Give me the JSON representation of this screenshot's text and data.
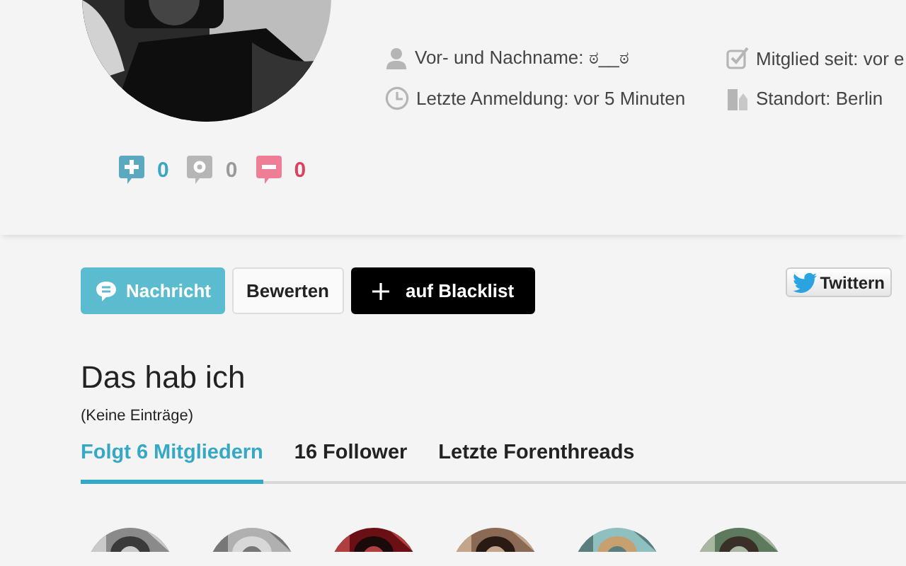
{
  "profile": {
    "info": [
      {
        "kind": "person",
        "text": "Vor- und Nachname: ಠ__ಠ"
      },
      {
        "kind": "check",
        "text": "Mitglied seit: vor e"
      },
      {
        "kind": "clock",
        "text": "Letzte Anmeldung: vor 5 Minuten"
      },
      {
        "kind": "city",
        "text": "Standort: Berlin"
      }
    ],
    "counters": [
      {
        "kind": "plus",
        "value": "0",
        "color": "#3aa6c2"
      },
      {
        "kind": "neutral",
        "value": "0",
        "color": "#9a9a9a"
      },
      {
        "kind": "minus",
        "value": "0",
        "color": "#d9435e"
      }
    ]
  },
  "actions": [
    {
      "kind": "primary",
      "label": "Nachricht"
    },
    {
      "kind": "default",
      "label": "Bewerten"
    },
    {
      "kind": "dark",
      "label": "auf Blacklist"
    }
  ],
  "share": [
    {
      "kind": "twitter",
      "label": "Twittern"
    }
  ],
  "section": {
    "title": "Das hab ich",
    "empty": "(Keine Einträge)"
  },
  "tabs": [
    {
      "label": "Folgt 6 Mitgliedern",
      "selected": true
    },
    {
      "label": "16 Follower",
      "selected": false
    },
    {
      "label": "Letzte Forenthreads",
      "selected": false
    }
  ]
}
